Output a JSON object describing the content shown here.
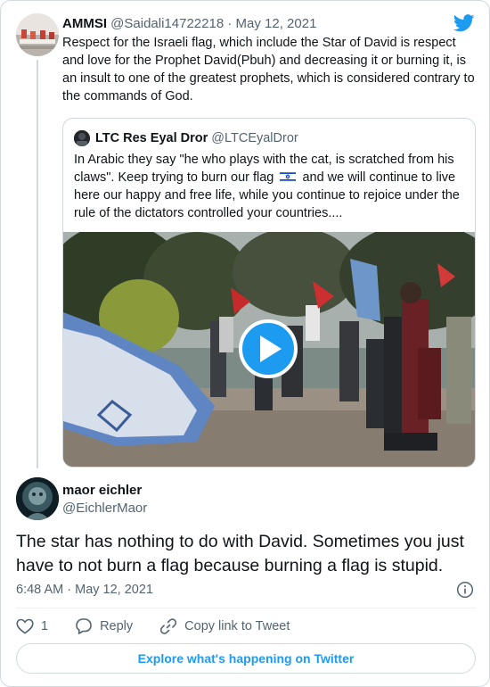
{
  "brand": {
    "accent": "#1d9bf0",
    "icon": "twitter-bird-icon"
  },
  "parent_tweet": {
    "name": "AMMSI",
    "handle": "@Saidali14722218",
    "separator": "·",
    "date": "May 12, 2021",
    "text": "Respect for the Israeli flag, which include the Star of David is respect and love for the Prophet David(Pbuh) and decreasing it or burning it, is an insult to one of the greatest prophets, which is considered contrary to the commands of God."
  },
  "quoted_tweet": {
    "name": "LTC Res Eyal Dror",
    "handle": "@LTCEyalDror",
    "text_before_flag": "In Arabic they say \"he who plays with the cat, is scratched from his claws\". Keep trying to burn our  flag",
    "flag_icon": "israel-flag-icon",
    "text_after_flag": "and we will continue to live here our happy and free life, while you continue to rejoice under the rule of the dictators controlled your countries....",
    "media": {
      "type": "video",
      "play_icon": "play-icon"
    }
  },
  "reply": {
    "name": "maor eichler",
    "handle": "@EichlerMaor",
    "text": "The star has nothing to do with David. Sometimes you just have to not burn a flag because burning a flag is stupid.",
    "time": "6:48 AM",
    "separator": "·",
    "date": "May 12, 2021"
  },
  "actions": {
    "like_count": "1",
    "reply_label": "Reply",
    "copy_label": "Copy link to Tweet"
  },
  "footer": {
    "explore_label": "Explore what's happening on Twitter"
  }
}
